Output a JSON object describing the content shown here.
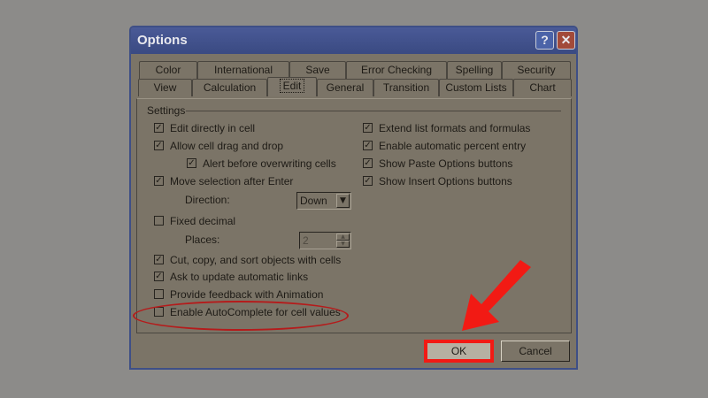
{
  "window": {
    "title": "Options",
    "help_label": "?",
    "close_label": "✕"
  },
  "tabs_row1": [
    "Color",
    "International",
    "Save",
    "Error Checking",
    "Spelling",
    "Security"
  ],
  "tabs_row2": [
    "View",
    "Calculation",
    "Edit",
    "General",
    "Transition",
    "Custom Lists",
    "Chart"
  ],
  "active_tab": "Edit",
  "settings": {
    "group_label": "Settings",
    "edit_directly": {
      "label": "Edit directly in cell",
      "checked": true
    },
    "allow_drag": {
      "label": "Allow cell drag and drop",
      "checked": true
    },
    "alert_overwrite": {
      "label": "Alert before overwriting cells",
      "checked": true
    },
    "move_selection": {
      "label": "Move selection after Enter",
      "checked": true
    },
    "direction": {
      "label": "Direction:",
      "value": "Down"
    },
    "fixed_decimal": {
      "label": "Fixed decimal",
      "checked": false
    },
    "places": {
      "label": "Places:",
      "value": "2"
    },
    "cut_copy_sort": {
      "label": "Cut, copy, and sort objects with cells",
      "checked": true
    },
    "update_links": {
      "label": "Ask to update automatic links",
      "checked": true
    },
    "feedback_animation": {
      "label": "Provide feedback with Animation",
      "checked": false
    },
    "autocomplete": {
      "label": "Enable AutoComplete for cell values",
      "checked": false
    },
    "extend_list": {
      "label": "Extend list formats and formulas",
      "checked": true
    },
    "auto_percent": {
      "label": "Enable automatic percent entry",
      "checked": true
    },
    "paste_options": {
      "label": "Show Paste Options buttons",
      "checked": true
    },
    "insert_options": {
      "label": "Show Insert Options buttons",
      "checked": true
    }
  },
  "buttons": {
    "ok": "OK",
    "cancel": "Cancel"
  },
  "colors": {
    "highlight": "#f21a14",
    "title_bar": "#3e4f86",
    "ellipse": "#b51b1b"
  }
}
